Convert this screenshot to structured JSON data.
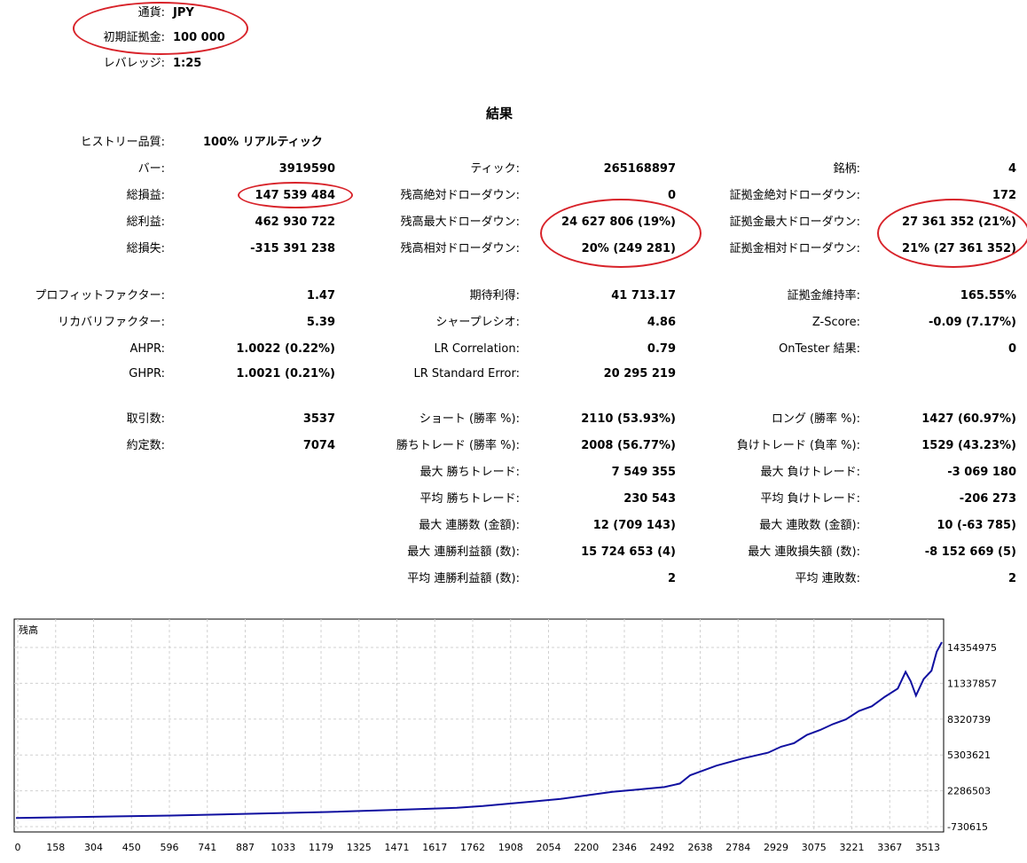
{
  "header": {
    "currency_label": "通貨:",
    "currency_value": "JPY",
    "deposit_label": "初期証拠金:",
    "deposit_value": "100 000",
    "leverage_label": "レバレッジ:",
    "leverage_value": "1:25"
  },
  "results_title": "結果",
  "history_quality": {
    "label": "ヒストリー品質:",
    "value": "100% リアルティック"
  },
  "rows": [
    {
      "c1l": "バー:",
      "c1v": "3919590",
      "c2l": "ティック:",
      "c2v": "265168897",
      "c3l": "銘柄:",
      "c3v": "4"
    },
    {
      "c1l": "総損益:",
      "c1v": "147 539 484",
      "c2l": "残高絶対ドローダウン:",
      "c2v": "0",
      "c3l": "証拠金絶対ドローダウン:",
      "c3v": "172"
    },
    {
      "c1l": "総利益:",
      "c1v": "462 930 722",
      "c2l": "残高最大ドローダウン:",
      "c2v": "24 627 806 (19%)",
      "c3l": "証拠金最大ドローダウン:",
      "c3v": "27 361 352 (21%)"
    },
    {
      "c1l": "総損失:",
      "c1v": "-315 391 238",
      "c2l": "残高相対ドローダウン:",
      "c2v": "20% (249 281)",
      "c3l": "証拠金相対ドローダウン:",
      "c3v": "21% (27 361 352)"
    },
    {
      "c1l": "プロフィットファクター:",
      "c1v": "1.47",
      "c2l": "期待利得:",
      "c2v": "41 713.17",
      "c3l": "証拠金維持率:",
      "c3v": "165.55%"
    },
    {
      "c1l": "リカバリファクター:",
      "c1v": "5.39",
      "c2l": "シャープレシオ:",
      "c2v": "4.86",
      "c3l": "Z-Score:",
      "c3v": "-0.09 (7.17%)"
    },
    {
      "c1l": "AHPR:",
      "c1v": "1.0022 (0.22%)",
      "c2l": "LR Correlation:",
      "c2v": "0.79",
      "c3l": "OnTester 結果:",
      "c3v": "0"
    },
    {
      "c1l": "GHPR:",
      "c1v": "1.0021 (0.21%)",
      "c2l": "LR Standard Error:",
      "c2v": "20 295 219",
      "c3l": "",
      "c3v": ""
    },
    {
      "c1l": "取引数:",
      "c1v": "3537",
      "c2l": "ショート (勝率 %):",
      "c2v": "2110 (53.93%)",
      "c3l": "ロング (勝率 %):",
      "c3v": "1427 (60.97%)"
    },
    {
      "c1l": "約定数:",
      "c1v": "7074",
      "c2l": "勝ちトレード (勝率 %):",
      "c2v": "2008 (56.77%)",
      "c3l": "負けトレード (負率 %):",
      "c3v": "1529 (43.23%)"
    },
    {
      "c1l": "",
      "c1v": "",
      "c2l": "最大 勝ちトレード:",
      "c2v": "7 549 355",
      "c3l": "最大 負けトレード:",
      "c3v": "-3 069 180"
    },
    {
      "c1l": "",
      "c1v": "",
      "c2l": "平均 勝ちトレード:",
      "c2v": "230 543",
      "c3l": "平均 負けトレード:",
      "c3v": "-206 273"
    },
    {
      "c1l": "",
      "c1v": "",
      "c2l": "最大 連勝数 (金額):",
      "c2v": "12 (709 143)",
      "c3l": "最大 連敗数 (金額):",
      "c3v": "10 (-63 785)"
    },
    {
      "c1l": "",
      "c1v": "",
      "c2l": "最大 連勝利益額 (数):",
      "c2v": "15 724 653 (4)",
      "c3l": "最大 連敗損失額 (数):",
      "c3v": "-8 152 669 (5)"
    },
    {
      "c1l": "",
      "c1v": "",
      "c2l": "平均 連勝利益額 (数):",
      "c2v": "2",
      "c3l": "平均 連敗数:",
      "c3v": "2"
    }
  ],
  "colors": {
    "line": "#1010a0",
    "grid": "#d0d0d0",
    "annotation": "#d8232a"
  },
  "chart_data": {
    "type": "line",
    "title": "残高",
    "x_ticks": [
      "0",
      "158",
      "304",
      "450",
      "596",
      "741",
      "887",
      "1033",
      "1179",
      "1325",
      "1471",
      "1617",
      "1762",
      "1908",
      "2054",
      "2200",
      "2346",
      "2492",
      "2638",
      "2784",
      "2929",
      "3075",
      "3221",
      "3367",
      "3513"
    ],
    "y_ticks": [
      "14354975",
      "11337857",
      "8320739",
      "5303621",
      "2286503",
      "-730615"
    ],
    "x_range": [
      0,
      3570
    ],
    "y_range": [
      -730615,
      15500000
    ],
    "series": [
      {
        "x": [
          0,
          300,
          600,
          900,
          1200,
          1500,
          1700,
          1800,
          1900,
          2000,
          2100,
          2200,
          2300,
          2400,
          2500,
          2560,
          2600,
          2650,
          2700,
          2800,
          2900,
          2950,
          3000,
          3050,
          3100,
          3150,
          3200,
          3250,
          3300,
          3350,
          3400,
          3430,
          3450,
          3470,
          3500,
          3530,
          3550,
          3570
        ],
        "y": [
          0,
          100000,
          200000,
          350000,
          500000,
          700000,
          850000,
          1000000,
          1200000,
          1400000,
          1600000,
          1900000,
          2200000,
          2400000,
          2600000,
          2900000,
          3600000,
          4000000,
          4400000,
          5000000,
          5500000,
          6000000,
          6300000,
          7000000,
          7400000,
          7900000,
          8300000,
          9000000,
          9400000,
          10200000,
          10900000,
          12300000,
          11500000,
          10300000,
          11700000,
          12400000,
          14000000,
          14800000
        ]
      }
    ]
  }
}
